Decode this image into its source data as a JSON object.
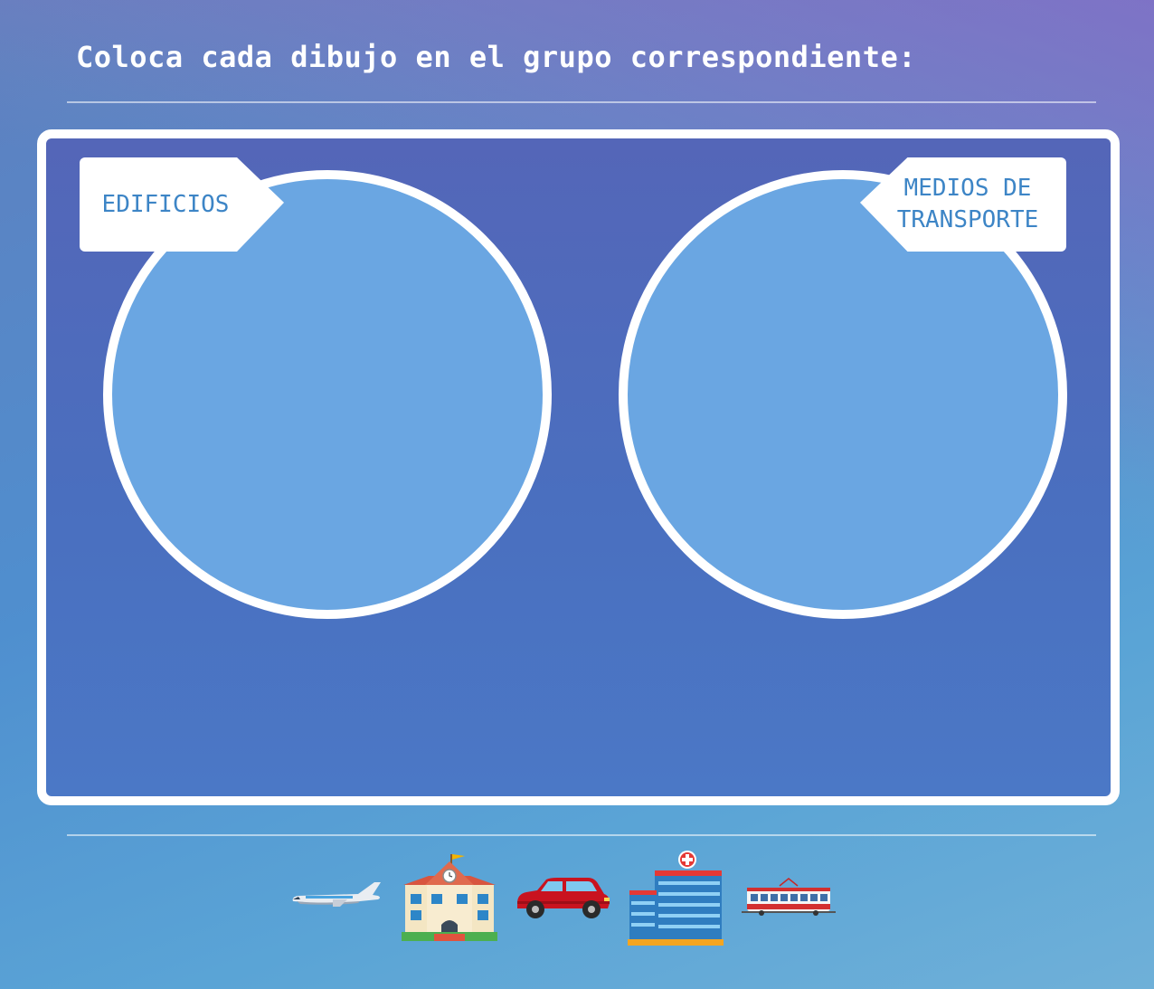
{
  "instruction": "Coloca cada dibujo en el grupo correspondiente:",
  "groups": [
    {
      "label": "EDIFICIOS"
    },
    {
      "label": "MEDIOS DE TRANSPORTE"
    }
  ],
  "items": [
    {
      "icon": "airplane-icon"
    },
    {
      "icon": "school-icon"
    },
    {
      "icon": "car-icon"
    },
    {
      "icon": "hospital-icon"
    },
    {
      "icon": "tram-icon"
    }
  ],
  "colors": {
    "board_border": "#ffffff",
    "circle_fill": "#6aa6e2",
    "label_text": "#3d85c6"
  }
}
